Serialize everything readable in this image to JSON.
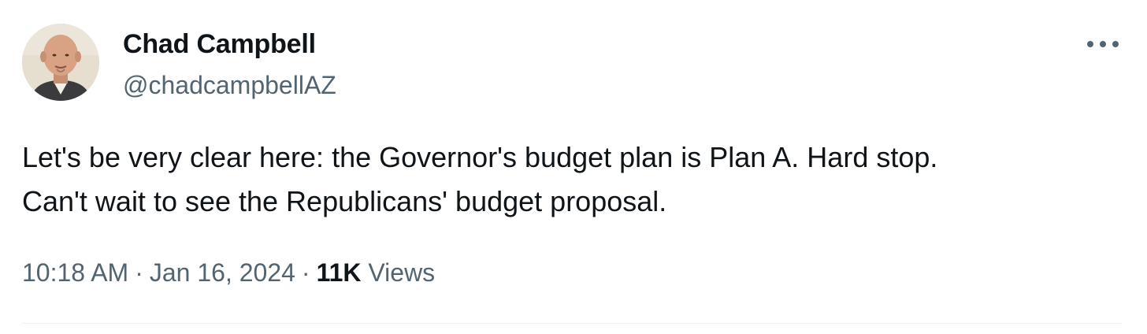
{
  "author": {
    "display_name": "Chad Campbell",
    "handle": "@chadcampbellAZ",
    "avatar_icon": "profile-photo"
  },
  "tweet": {
    "text": "Let's be very clear here: the Governor's budget plan is Plan A. Hard stop.\nCan't wait to see the Republicans' budget proposal."
  },
  "meta": {
    "time": "10:18 AM",
    "separator": "·",
    "date": "Jan 16, 2024",
    "views_count": "11K",
    "views_label": "Views"
  },
  "actions": {
    "more_icon": "more-horizontal-icon"
  },
  "colors": {
    "text_primary": "#0f1419",
    "text_secondary": "#536471",
    "divider": "#eff3f4",
    "background": "#ffffff"
  }
}
